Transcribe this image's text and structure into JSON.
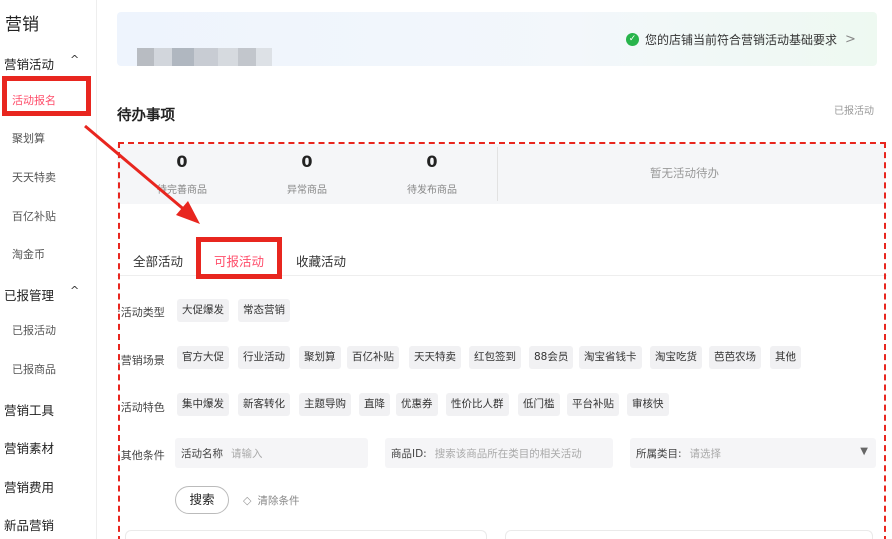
{
  "sidebar": {
    "title": "营销",
    "groups": [
      {
        "label": "营销活动",
        "caret": "^"
      },
      {
        "label": "已报管理",
        "caret": "^"
      },
      {
        "label": "营销工具"
      },
      {
        "label": "营销素材"
      },
      {
        "label": "营销费用"
      },
      {
        "label": "新品营销"
      }
    ],
    "activity_items": [
      "活动报名",
      "聚划算",
      "天天特卖",
      "百亿补贴",
      "淘金币"
    ],
    "reported_items": [
      "已报活动",
      "已报商品"
    ]
  },
  "banner": {
    "status_text": "您的店铺当前符合营销活动基础要求",
    "chevron": ">"
  },
  "todo": {
    "title": "待办事项",
    "link": "已报活动",
    "stats": [
      {
        "value": "0",
        "label": "待完善商品"
      },
      {
        "value": "0",
        "label": "异常商品"
      },
      {
        "value": "0",
        "label": "待发布商品"
      }
    ],
    "empty_text": "暂无活动待办"
  },
  "tabs": [
    "全部活动",
    "可报活动",
    "收藏活动"
  ],
  "filters": {
    "type_label": "活动类型:",
    "types": [
      "大促爆发",
      "常态营销"
    ],
    "scene_label": "营销场景:",
    "scenes": [
      "官方大促",
      "行业活动",
      "聚划算",
      "百亿补贴",
      "天天特卖",
      "红包签到",
      "88会员",
      "淘宝省钱卡",
      "淘宝吃货",
      "芭芭农场",
      "其他"
    ],
    "feature_label": "活动特色:",
    "features": [
      "集中爆发",
      "新客转化",
      "主题导购",
      "直降",
      "优惠券",
      "性价比人群",
      "低门槛",
      "平台补贴",
      "审核快"
    ],
    "other_label": "其他条件:",
    "activity_name_label": "活动名称",
    "activity_name_placeholder": "请输入",
    "product_id_label": "商品ID:",
    "product_id_placeholder": "搜索该商品所在类目的相关活动",
    "category_label": "所属类目:",
    "category_placeholder": "请选择"
  },
  "actions": {
    "search": "搜索",
    "clear": "清除条件"
  },
  "colors": {
    "accent": "#ff4d6a",
    "annotation": "#e8261f",
    "success": "#28b44b"
  }
}
